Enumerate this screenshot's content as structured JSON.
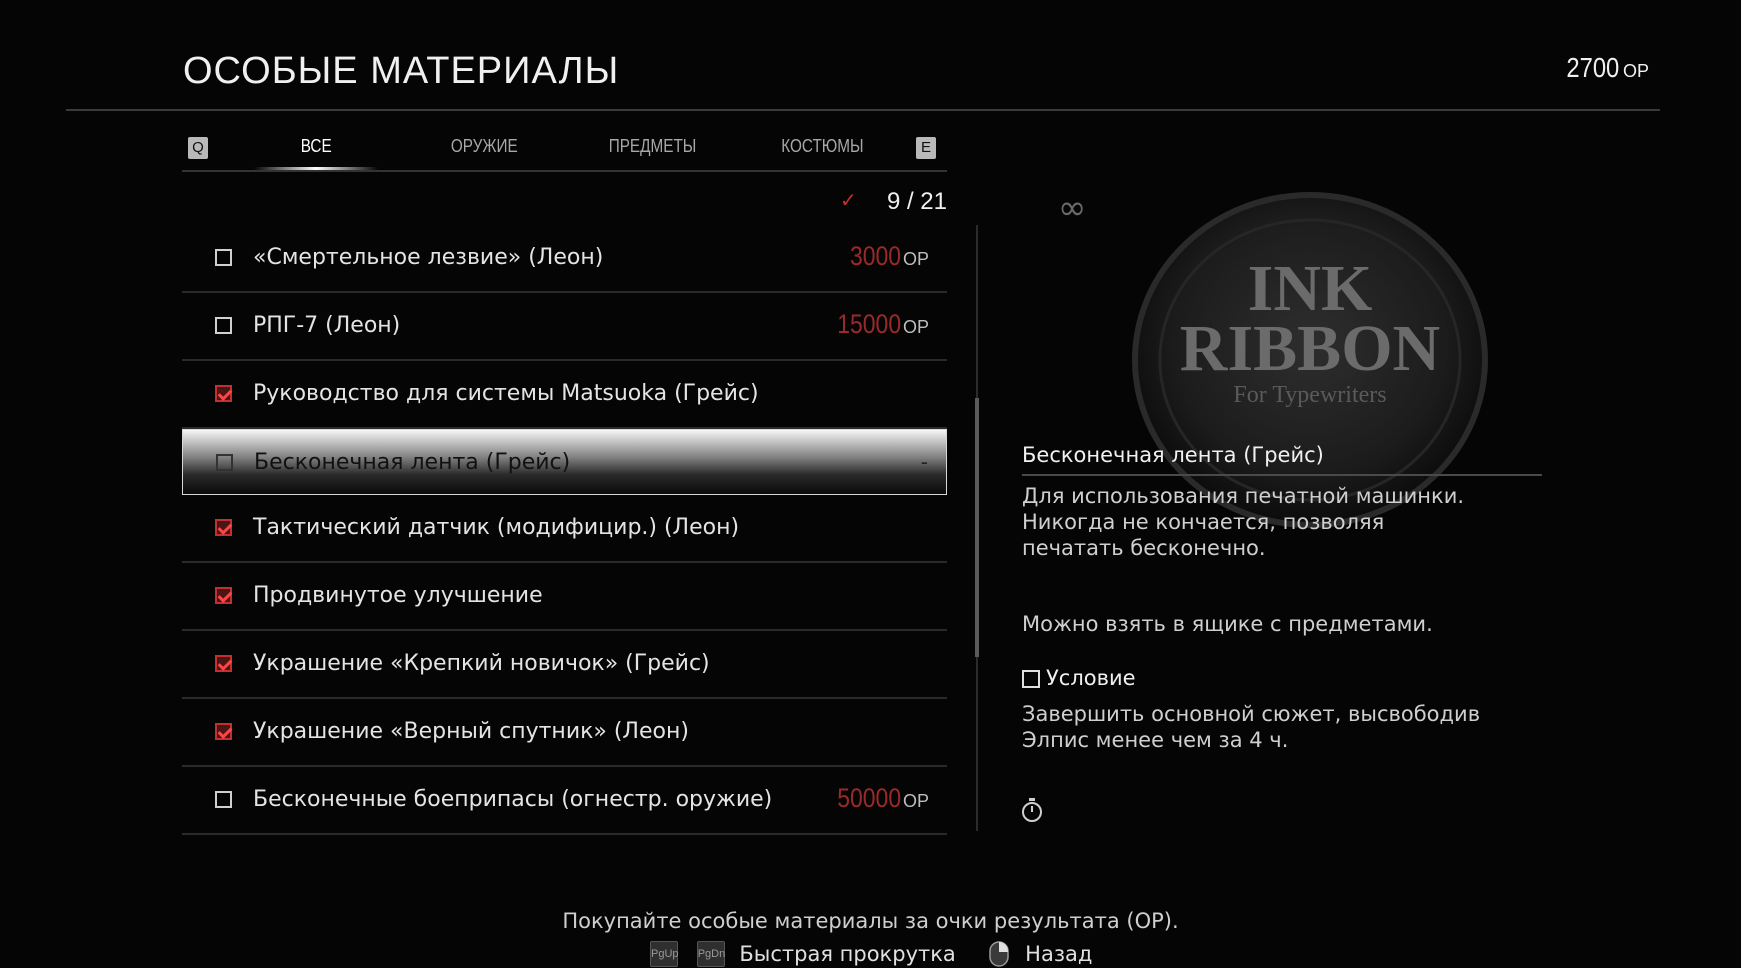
{
  "header": {
    "title": "ОСОБЫЕ МАТЕРИАЛЫ",
    "points_value": "2700",
    "points_unit": "ОР"
  },
  "tabs": {
    "prev_key": "Q",
    "next_key": "E",
    "items": [
      {
        "label": "ВСЕ",
        "active": true
      },
      {
        "label": "ОРУЖИЕ",
        "active": false
      },
      {
        "label": "ПРЕДМЕТЫ",
        "active": false
      },
      {
        "label": "КОСТЮМЫ",
        "active": false
      }
    ]
  },
  "counter": {
    "check_icon": "check-icon",
    "value": "9 / 21"
  },
  "items": [
    {
      "name": "«Смертельное лезвие» (Леон)",
      "checked": false,
      "price": "3000",
      "unit": "ОР",
      "selected": false
    },
    {
      "name": "РПГ-7 (Леон)",
      "checked": false,
      "price": "15000",
      "unit": "ОР",
      "selected": false
    },
    {
      "name": "Руководство для системы Matsuoka (Грейс)",
      "checked": true,
      "price": "",
      "unit": "",
      "selected": false
    },
    {
      "name": "Бесконечная лента (Грейс)",
      "checked": false,
      "price": "",
      "unit": "",
      "dash": "-",
      "selected": true
    },
    {
      "name": "Тактический датчик (модифицир.) (Леон)",
      "checked": true,
      "price": "",
      "unit": "",
      "selected": false
    },
    {
      "name": "Продвинутое улучшение",
      "checked": true,
      "price": "",
      "unit": "",
      "selected": false
    },
    {
      "name": "Украшение «Крепкий новичок» (Грейс)",
      "checked": true,
      "price": "",
      "unit": "",
      "selected": false
    },
    {
      "name": "Украшение «Верный спутник» (Леон)",
      "checked": true,
      "price": "",
      "unit": "",
      "selected": false
    },
    {
      "name": "Бесконечные боеприпасы (огнестр. оружие)",
      "checked": false,
      "price": "50000",
      "unit": "ОР",
      "selected": false
    }
  ],
  "detail": {
    "image_text": {
      "line1": "INK",
      "line2": "RIBBON",
      "line3": "For Typewriters"
    },
    "infinity_icon": "infinity-icon",
    "name": "Бесконечная лента (Грейс)",
    "description": "Для использования печатной машинки. Никогда не кончается, позволяя печатать бесконечно.",
    "location": "Можно взять в ящике с предметами.",
    "condition_title": "Условие",
    "condition_text": "Завершить основной сюжет, высвободив Элпис менее чем за 4 ч.",
    "timer_icon": "stopwatch-icon"
  },
  "footer": {
    "tip": "Покупайте особые материалы за очки результата (ОР).",
    "pgup": "PgUp",
    "pgdn": "PgDn",
    "scroll_label": "Быстрая прокрутка",
    "back_label": "Назад"
  },
  "colors": {
    "background": "#050505",
    "accent_red": "#c43030",
    "price_red": "#9a2a2a"
  }
}
